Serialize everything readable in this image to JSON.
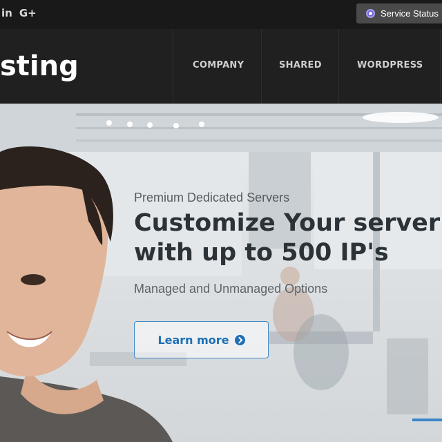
{
  "topbar": {
    "social_icons": [
      {
        "name": "linkedin-icon",
        "glyph": "in"
      },
      {
        "name": "google-plus-icon",
        "glyph": "G+"
      }
    ],
    "service_status_label": "Service Status"
  },
  "header": {
    "logo_text": "sting",
    "nav": [
      {
        "label": "COMPANY"
      },
      {
        "label": "SHARED"
      },
      {
        "label": "WORDPRESS"
      }
    ]
  },
  "hero": {
    "subtitle": "Premium Dedicated Servers",
    "title_line1": "Customize Your server",
    "title_line2": "with up to 500 IP's",
    "description": "Managed and Unmanaged Options",
    "cta_label": "Learn more"
  },
  "colors": {
    "accent": "#1e6fb5",
    "topbar_bg": "#191919",
    "header_bg": "#202020",
    "status_icon": "#6c63d9"
  }
}
